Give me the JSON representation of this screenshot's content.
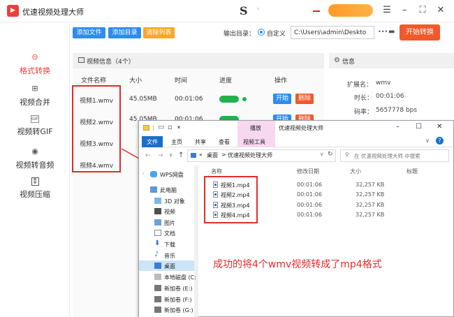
{
  "app": {
    "title": "优速视频处理大师",
    "logo_text": "▶",
    "logo_letter": "S",
    "title_mark": "◦",
    "window_controls": [
      "☰",
      "–",
      "⛶",
      "✕"
    ]
  },
  "sidebar": {
    "items": [
      {
        "label": "格式转换",
        "icon": "⊝",
        "active": true
      },
      {
        "label": "视频合并",
        "icon": "⊞",
        "active": false
      },
      {
        "label": "视频转GIF",
        "icon": "GIF",
        "active": false
      },
      {
        "label": "视频转音频",
        "icon": "◉",
        "active": false
      },
      {
        "label": "视频压缩",
        "icon": "⇕",
        "active": false
      }
    ]
  },
  "toolbar": {
    "add_file": "添加文件",
    "add_folder": "添加目录",
    "clear_list": "清除列表",
    "output_label": "输出目录：",
    "custom_label": "自定义",
    "output_path": "C:\\Users\\admin\\Deskto",
    "more_icon": "•••",
    "folder_icon": "▬",
    "start_convert": "开始转换"
  },
  "file_panel": {
    "title": "视频信息（4个）",
    "headers": [
      "文件名称",
      "大小",
      "时间",
      "进度",
      "操作"
    ],
    "rows": [
      {
        "name": "视频1.wmv",
        "size": "45.05MB",
        "time": "00:01:06",
        "start": "开始",
        "delete": "删除"
      },
      {
        "name": "视频2.wmv",
        "size": "45.05MB",
        "time": "00:01:06",
        "start": "开始",
        "delete": "删除"
      },
      {
        "name": "视频3.wmv",
        "size": "",
        "time": "",
        "start": "",
        "delete": ""
      },
      {
        "name": "视频4.wmv",
        "size": "",
        "time": "",
        "start": "",
        "delete": ""
      }
    ]
  },
  "info_panel": {
    "title": "信息",
    "rows": [
      {
        "label": "扩展名：",
        "value": "wmv"
      },
      {
        "label": "时长：",
        "value": "00:01:06"
      },
      {
        "label": "码率：",
        "value": "5657778 bps"
      }
    ]
  },
  "explorer": {
    "title": "优速视频处理大师",
    "context_tab": "播放",
    "context_group": "视频工具",
    "ribbon_tabs": [
      "文件",
      "主页",
      "共享",
      "查看"
    ],
    "window_controls": [
      "–",
      "☐",
      "✕"
    ],
    "nav": [
      "←",
      "→",
      "∨",
      "↑"
    ],
    "address": [
      "«",
      "桌面",
      ">",
      "优速视频处理大师"
    ],
    "address_caret": "∨",
    "refresh": "↻",
    "search_placeholder": "在 优速视频处理大师 中搜索",
    "columns": [
      "名称",
      "修改日期",
      "日期",
      "大小",
      "标题"
    ],
    "col_sort": "∧",
    "tree": [
      "WPS网盘",
      "此电脑",
      "3D 对象",
      "视频",
      "图片",
      "文档",
      "下载",
      "音乐",
      "桌面",
      "本地磁盘 (C:",
      "新加卷 (E:)",
      "新加卷 (F:)",
      "新加卷 (G:)"
    ],
    "tree_expand": "›",
    "files": [
      {
        "name": "视频1.mp4",
        "date": "00:01:06",
        "size": "32,257 KB"
      },
      {
        "name": "视频2.mp4",
        "date": "00:01:06",
        "size": "32,257 KB"
      },
      {
        "name": "视频3.mp4",
        "date": "00:01:06",
        "size": "32,257 KB"
      },
      {
        "name": "视频4.mp4",
        "date": "00:01:06",
        "size": "32,257 KB"
      }
    ],
    "quick_access": [
      "▭",
      "▫",
      "▾"
    ],
    "help": "?"
  },
  "annotation": "成功的将4个wmv视频转成了mp4格式",
  "colors": {
    "accent_red": "#e8403a",
    "primary_blue": "#2d8cf0",
    "orange": "#f1592a",
    "progress_green": "#22b14c"
  }
}
